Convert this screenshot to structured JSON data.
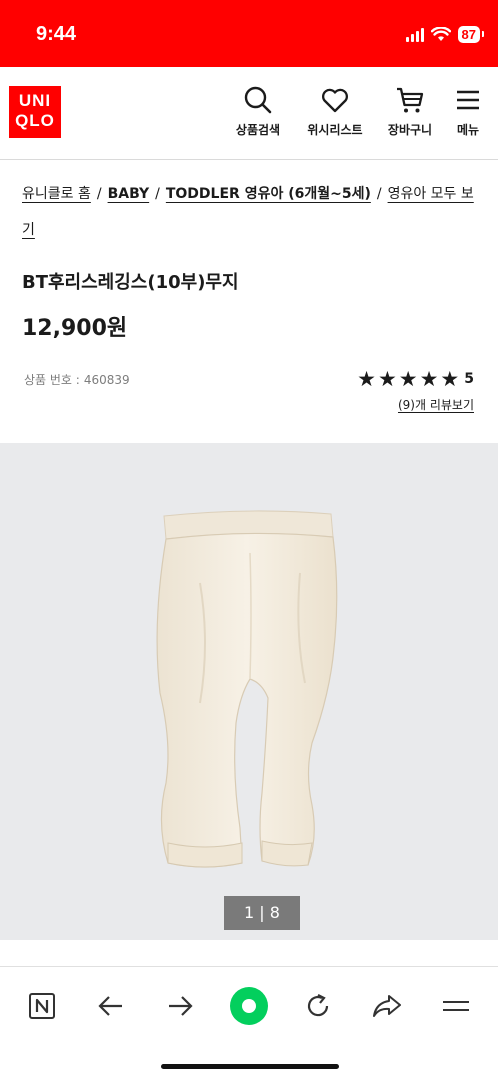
{
  "status_bar": {
    "time": "9:44",
    "battery": "87",
    "icons": [
      "signal-icon",
      "wifi-icon",
      "battery-icon"
    ]
  },
  "header": {
    "logo_line1": "UNI",
    "logo_line2": "QLO",
    "nav": [
      {
        "icon": "search-icon",
        "label": "상품검색"
      },
      {
        "icon": "heart-icon",
        "label": "위시리스트"
      },
      {
        "icon": "cart-icon",
        "label": "장바구니"
      },
      {
        "icon": "menu-icon",
        "label": "메뉴"
      }
    ]
  },
  "breadcrumb": {
    "items": [
      "유니클로 홈",
      "BABY",
      "TODDLER 영유아 (6개월~5세)",
      "영유아 모두 보기"
    ]
  },
  "product": {
    "title": "BT후리스레깅스(10부)무지",
    "price": "12,900원",
    "code_label": "상품 번호 :",
    "code_value": "460839",
    "rating_value": "5",
    "stars": 5,
    "review_link": "(9)개 리뷰보기"
  },
  "gallery": {
    "counter": "1 | 8",
    "current": 1,
    "total": 8
  },
  "browser_bar": {
    "buttons": [
      "tabs-icon",
      "back-icon",
      "forward-icon",
      "naver-green-dot-icon",
      "reload-icon",
      "share-icon",
      "menu-icon"
    ]
  },
  "colors": {
    "brand_red": "#ff0000",
    "image_bg": "#e9eaec",
    "counter_bg": "#7a7a7a",
    "naver_green": "#03cf5d"
  }
}
